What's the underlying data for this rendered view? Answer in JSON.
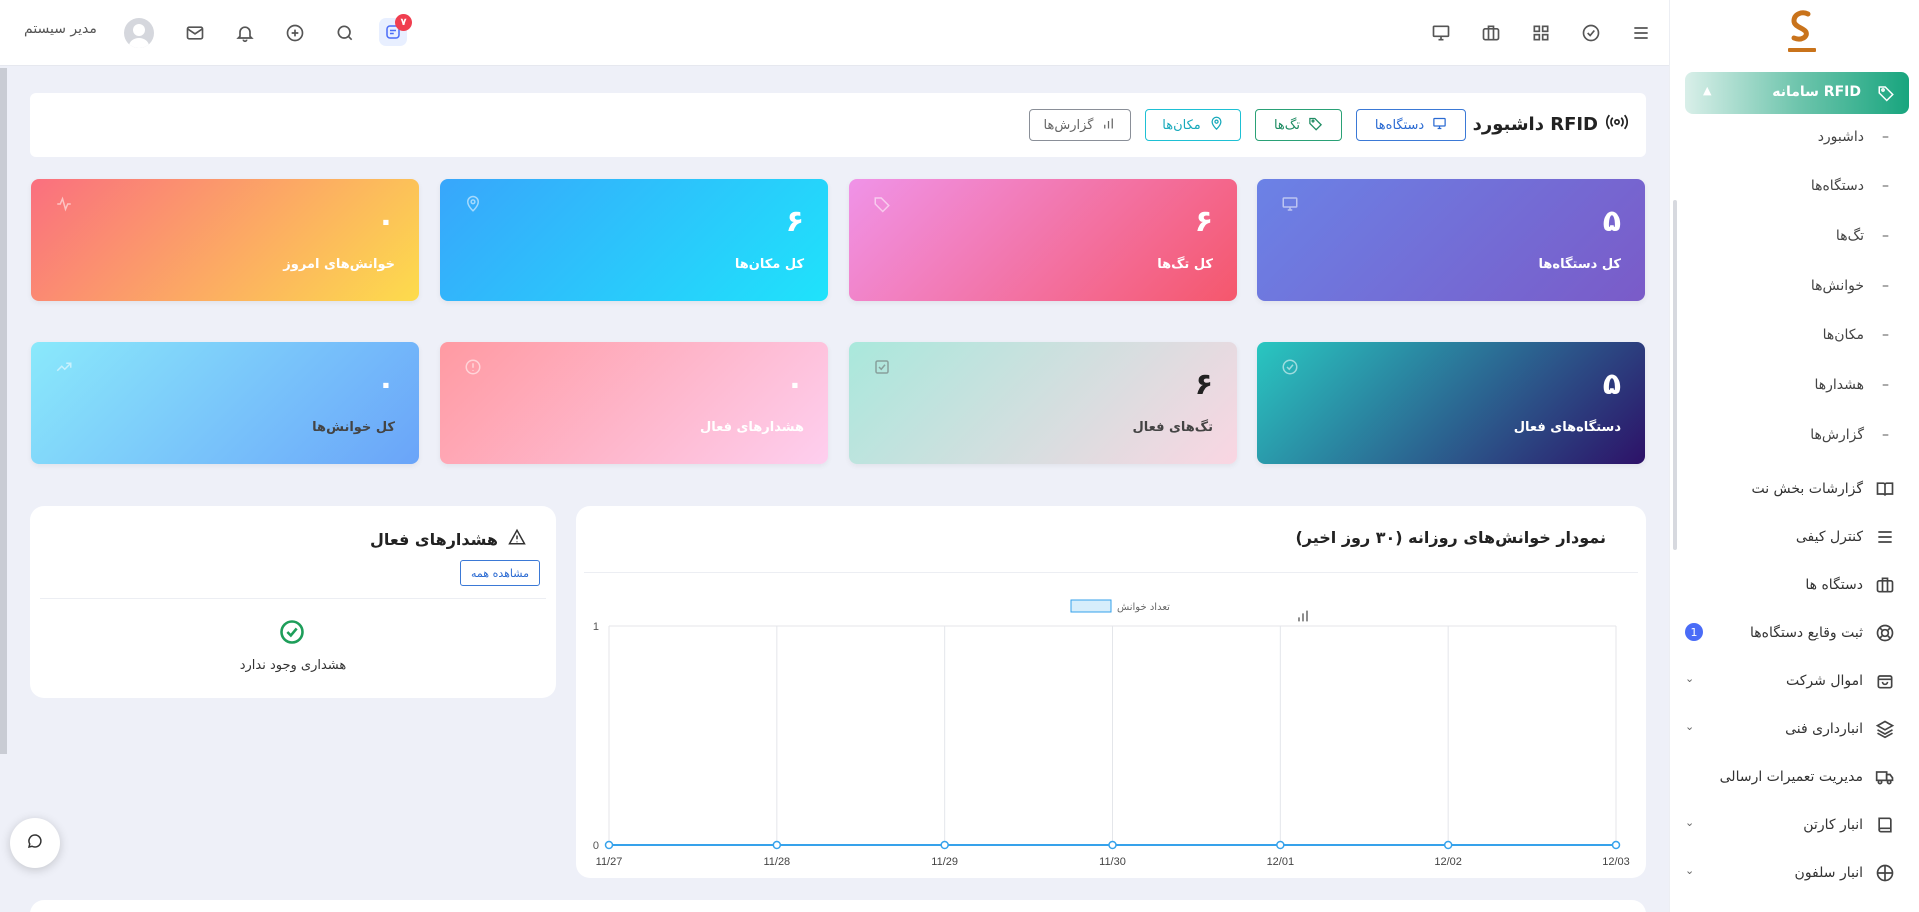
{
  "topbar": {
    "user_name": "مدیر سیستم",
    "notification_count": "۷",
    "icons": [
      "chat-icon",
      "search-icon",
      "plus-icon",
      "bell-icon",
      "mail-icon",
      "menu-icon",
      "check-circle-icon",
      "grid-icon",
      "briefcase-icon",
      "monitor-icon"
    ]
  },
  "sidebar": {
    "section_title": "سامانه RFID",
    "sub_items": [
      "داشبورد",
      "دستگاه‌ها",
      "تگ‌ها",
      "خوانش‌ها",
      "مکان‌ها",
      "هشدارها",
      "گزارش‌ها"
    ],
    "dash": "–",
    "menu": [
      {
        "label": "گزارشات بخش نت",
        "icon": "book-icon"
      },
      {
        "label": "کنترل کیفی",
        "icon": "list-icon"
      },
      {
        "label": "دستگاه ها",
        "icon": "briefcase-icon"
      },
      {
        "label": "ثبت وقایع دستگاه‌ها",
        "icon": "lifebuoy-icon",
        "badge": "1"
      },
      {
        "label": "اموال شرکت",
        "icon": "bag-icon",
        "chevron": true
      },
      {
        "label": "انبارداری فنی",
        "icon": "layers-icon",
        "chevron": true
      },
      {
        "label": "مدیریت تعمیرات ارسالی",
        "icon": "truck-icon"
      },
      {
        "label": "انبار کارتن",
        "icon": "book-icon",
        "chevron": true
      },
      {
        "label": "انبار سلفون",
        "icon": "target-icon",
        "chevron": true
      }
    ]
  },
  "header": {
    "title": "داشبورد RFID",
    "buttons": {
      "devices": "دستگاه‌ها",
      "tags": "تگ‌ها",
      "locations": "مکان‌ها",
      "reports": "گزارش‌ها"
    }
  },
  "stats": {
    "total_devices": {
      "value": "۵",
      "label": "کل دستگاه‌ها"
    },
    "total_tags": {
      "value": "۶",
      "label": "کل تگ‌ها"
    },
    "total_locations": {
      "value": "۶",
      "label": "کل مکان‌ها"
    },
    "today_reads": {
      "value": "۰",
      "label": "خوانش‌های امروز"
    },
    "active_devices": {
      "value": "۵",
      "label": "دستگاه‌های فعال"
    },
    "active_tags": {
      "value": "۶",
      "label": "تگ‌های فعال"
    },
    "active_alerts": {
      "value": "۰",
      "label": "هشدارهای فعال"
    },
    "total_reads": {
      "value": "۰",
      "label": "کل خوانش‌ها"
    }
  },
  "alerts_panel": {
    "title": "هشدارهای فعال",
    "view_all": "مشاهده همه",
    "empty_text": "هشداری وجود ندارد"
  },
  "chart_panel": {
    "title": "نمودار خوانش‌های روزانه (۳۰ روز اخیر)"
  },
  "chart_data": {
    "type": "line",
    "categories": [
      "11/27",
      "11/28",
      "11/29",
      "11/30",
      "12/01",
      "12/02",
      "12/03"
    ],
    "series": [
      {
        "name": "تعداد خوانش",
        "values": [
          0,
          0,
          0,
          0,
          0,
          0,
          0
        ]
      }
    ],
    "ylim": [
      0,
      1
    ],
    "yticks": [
      "0",
      "1"
    ],
    "legend": "top-center",
    "grid": true,
    "color": "#36a2eb"
  }
}
